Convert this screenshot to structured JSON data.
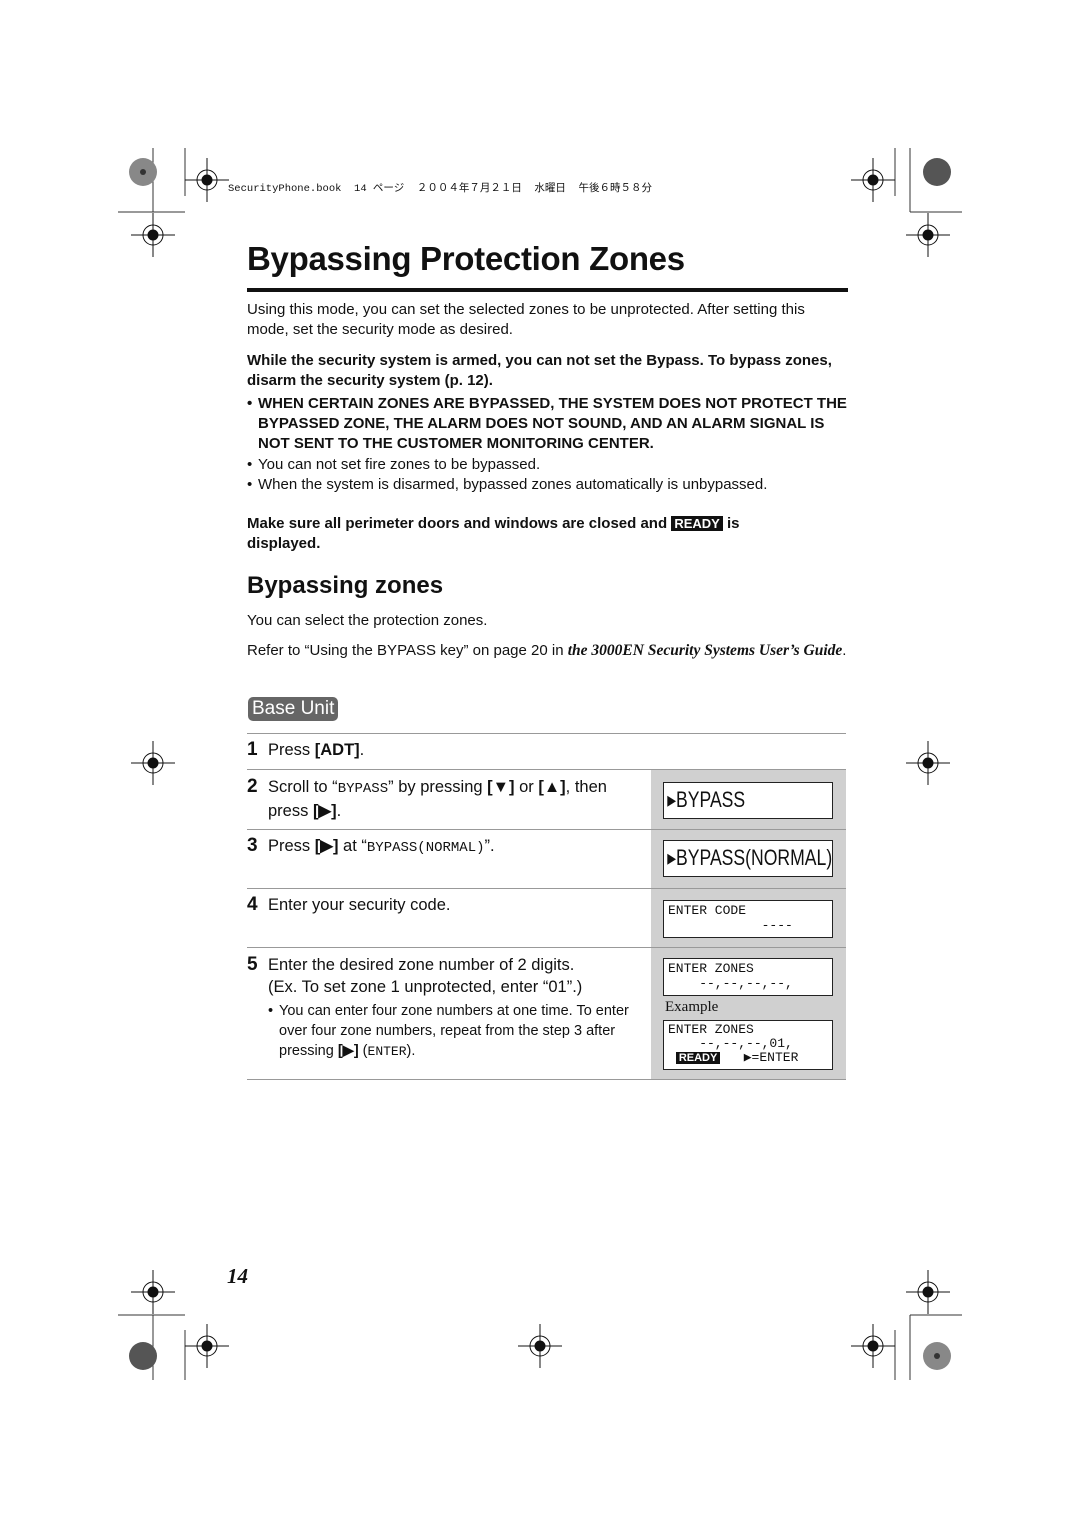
{
  "header_line": "SecurityPhone.book  14 ページ  ２００４年７月２１日  水曜日  午後６時５８分",
  "title": "Bypassing Protection Zones",
  "intro": "Using this mode, you can set the selected zones to be unprotected. After setting this mode, set the security mode as desired.",
  "note_bold": "While the security system is armed, you can not set the Bypass. To bypass zones, disarm the security system (p. 12).",
  "bullets": [
    "WHEN CERTAIN ZONES ARE BYPASSED, THE SYSTEM DOES NOT PROTECT THE BYPASSED ZONE, THE ALARM DOES NOT SOUND, AND AN ALARM SIGNAL IS NOT SENT TO THE CUSTOMER MONITORING CENTER.",
    "You can not set fire zones to be bypassed.",
    "When the system is disarmed, bypassed zones automatically is unbypassed."
  ],
  "ready_note": {
    "before": "Make sure all perimeter doors and windows are closed and",
    "badge": "READY",
    "after": "is displayed."
  },
  "subtitle": "Bypassing zones",
  "sub_intro": "You can select the protection zones.",
  "refer": {
    "text": "Refer to “Using the BYPASS key” on page 20 in ",
    "italic": "the 3000EN Security Systems User’s Guide",
    "end": "."
  },
  "base_unit": "Base Unit",
  "steps": [
    {
      "n": "1",
      "a": "Press ",
      "k": "[ADT]",
      "b": "."
    },
    {
      "n": "2",
      "a": "Scroll to “",
      "m": "BYPASS",
      "b": "” by pressing ",
      "k1": "[▼]",
      "c": " or ",
      "k2": "[▲]",
      "d": ", then",
      "e": "press ",
      "k3": "[▶]",
      "f": "."
    },
    {
      "n": "3",
      "a": "Press ",
      "k": "[▶]",
      "b": " at “",
      "m": "BYPASS(NORMAL)",
      "c": "”."
    },
    {
      "n": "4",
      "a": "Enter your security code."
    },
    {
      "n": "5",
      "a": "Enter the desired zone number of 2 digits.",
      "b": "(Ex. To set zone 1 unprotected, enter “01”.)",
      "bullet": "You can enter four zone numbers at one time. To enter over four zone numbers, repeat from the step 3 after pressing ",
      "k": "[▶]",
      "m": "ENTER",
      "end": ")."
    }
  ],
  "displays": {
    "d1": "▸BYPASS",
    "d2": "▸BYPASS(NORMAL)",
    "d3": [
      "ENTER CODE",
      "            ----"
    ],
    "d4": [
      "ENTER ZONES",
      "    --,--,--,--,"
    ],
    "example": "Example",
    "d5": [
      "ENTER ZONES",
      "    --,--,--,01,"
    ],
    "d5_ready": "READY",
    "d5_enter": "▶=ENTER"
  },
  "page_number": "14"
}
